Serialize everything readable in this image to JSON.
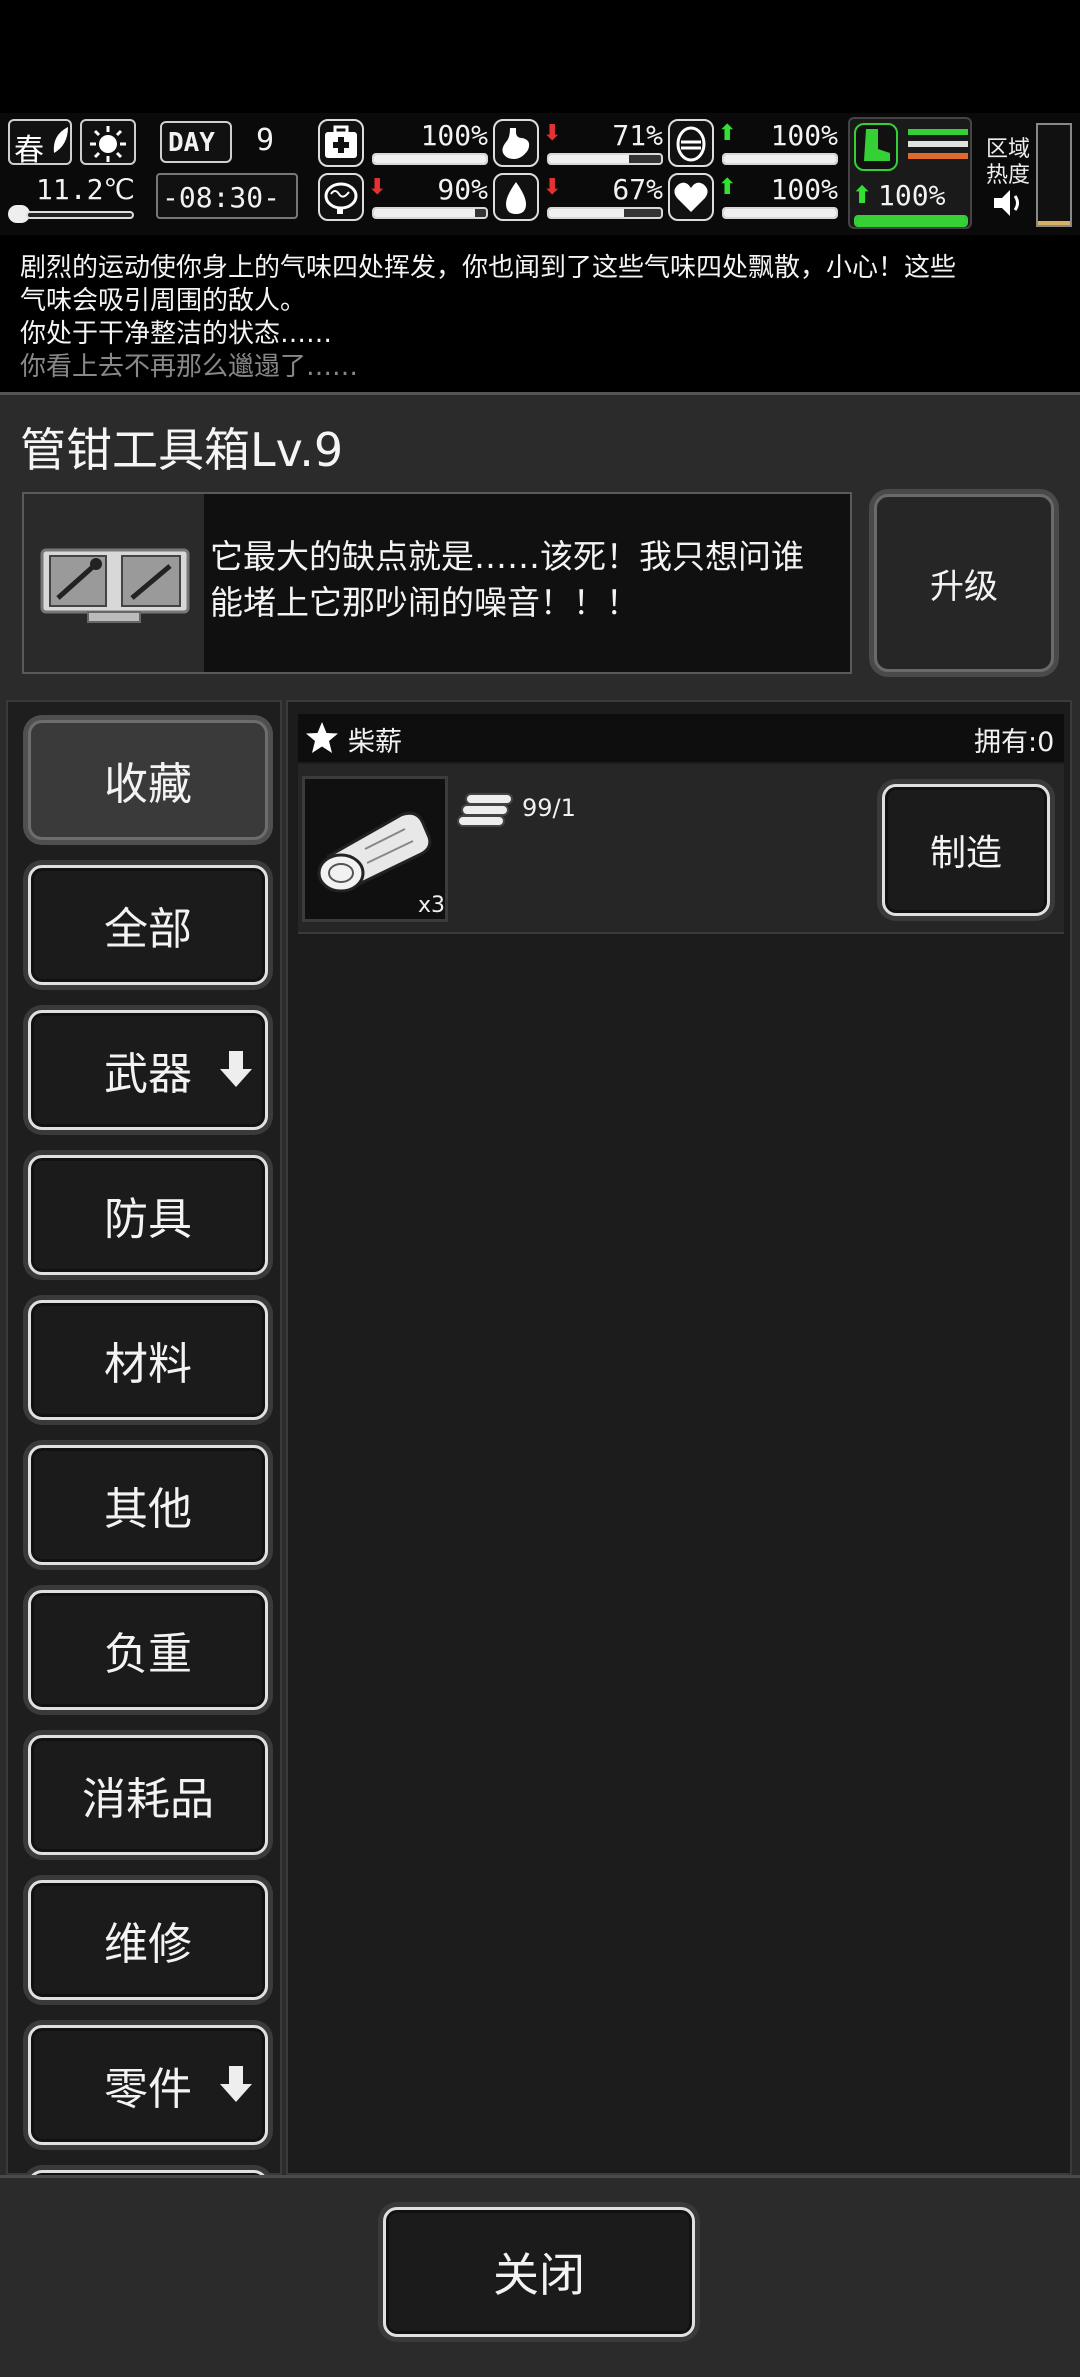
{
  "hud": {
    "season": "春",
    "weather_icon": "sun-icon",
    "temperature": "11.2℃",
    "day_label": "DAY",
    "day_number": "9",
    "time": "-08:30-",
    "stats": [
      {
        "icon": "medkit-icon",
        "trend": "",
        "value": "100%",
        "fill": 1.0
      },
      {
        "icon": "stomach-icon",
        "trend": "down",
        "value": "71%",
        "fill": 0.71
      },
      {
        "icon": "mask-icon",
        "trend": "up",
        "value": "100%",
        "fill": 1.0
      },
      {
        "icon": "brain-icon",
        "trend": "down",
        "value": "90%",
        "fill": 0.9
      },
      {
        "icon": "water-drop-icon",
        "trend": "down",
        "value": "67%",
        "fill": 0.67
      },
      {
        "icon": "heart-icon",
        "trend": "up",
        "value": "100%",
        "fill": 1.0
      }
    ],
    "stamina": {
      "icon": "boot-icon",
      "trend": "up",
      "value": "100%",
      "fill": 1.0
    },
    "area_label_1": "区域",
    "area_label_2": "热度",
    "sound_icon": "speaker-icon"
  },
  "log": {
    "line1": "剧烈的运动使你身上的气味四处挥发，你也闻到了这些气味四处飘散，小心！这些",
    "line2": "气味会吸引周围的敌人。",
    "line3": "你处于干净整洁的状态……",
    "line4": "你看上去不再那么邋遢了……"
  },
  "panel": {
    "title": "管钳工具箱Lv.9",
    "description_line1": "它最大的缺点就是……该死！我只想问谁",
    "description_line2": "能堵上它那吵闹的噪音！！！",
    "upgrade_label": "升级",
    "thumbnail_icon": "toolbox-icon"
  },
  "sidebar": {
    "items": [
      {
        "label": "收藏",
        "selected": true,
        "has_arrow": false
      },
      {
        "label": "全部",
        "selected": false,
        "has_arrow": false
      },
      {
        "label": "武器",
        "selected": false,
        "has_arrow": true
      },
      {
        "label": "防具",
        "selected": false,
        "has_arrow": false
      },
      {
        "label": "材料",
        "selected": false,
        "has_arrow": false
      },
      {
        "label": "其他",
        "selected": false,
        "has_arrow": false
      },
      {
        "label": "负重",
        "selected": false,
        "has_arrow": false
      },
      {
        "label": "消耗品",
        "selected": false,
        "has_arrow": false
      },
      {
        "label": "维修",
        "selected": false,
        "has_arrow": false
      },
      {
        "label": "零件",
        "selected": false,
        "has_arrow": true
      }
    ]
  },
  "recipe": {
    "name": "柴薪",
    "owned": "拥有:0",
    "icon": "firewood-icon",
    "quantity": "x3",
    "requirement_icon": "logs-icon",
    "requirement": "99/1",
    "craft_label": "制造"
  },
  "footer": {
    "close_label": "关闭"
  }
}
